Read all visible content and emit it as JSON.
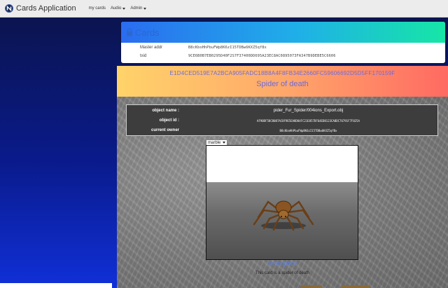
{
  "navbar": {
    "brand": "Cards Application",
    "items": [
      {
        "label": "my cards",
        "dropdown": false
      },
      {
        "label": "Audio",
        "dropdown": true
      },
      {
        "label": "Admin",
        "dropdown": true
      }
    ]
  },
  "cards_panel": {
    "title": "Cards",
    "master_addr_label": "Master addr",
    "master_addr_value": "B8cKboHhPbuFWp8K6zI15TDBw6KXZ5qf8x",
    "txid_label": "txid",
    "txid_value": "9CE6B0B7EB0295D40F2S7F37400DD695A23EC8AC0895073FA347B9DEBE5C6606"
  },
  "card": {
    "hash": "E1D4CED519E7A2BCA905FADC18B8A4F8FB34E2660FC59606692D5D5FF170159F",
    "name": "Spider of death",
    "object_name_label": "object name :",
    "object_name_value": "pider_Fur_Spider/004ions_Export.obj",
    "object_id_label": "object id :",
    "object_id_value": "AF90DF58C8087AC8F9E5EA8D84FC21E857DF64ED8123CABDC76791F7F025A",
    "owner_label": "current owner",
    "owner_value": "B8cKboHhPbuFWp8K6zI15TDBw6KXZ5qfBx",
    "material_select": "marble",
    "description_title": "description",
    "description_text": "This card is a spider of death"
  },
  "colors": {
    "accent_blue": "#2c67d0",
    "header_gradient": [
      "#ffd36a",
      "#ff6a62"
    ],
    "cards_gradient": [
      "#2a6cf0",
      "#16e6a6"
    ]
  }
}
